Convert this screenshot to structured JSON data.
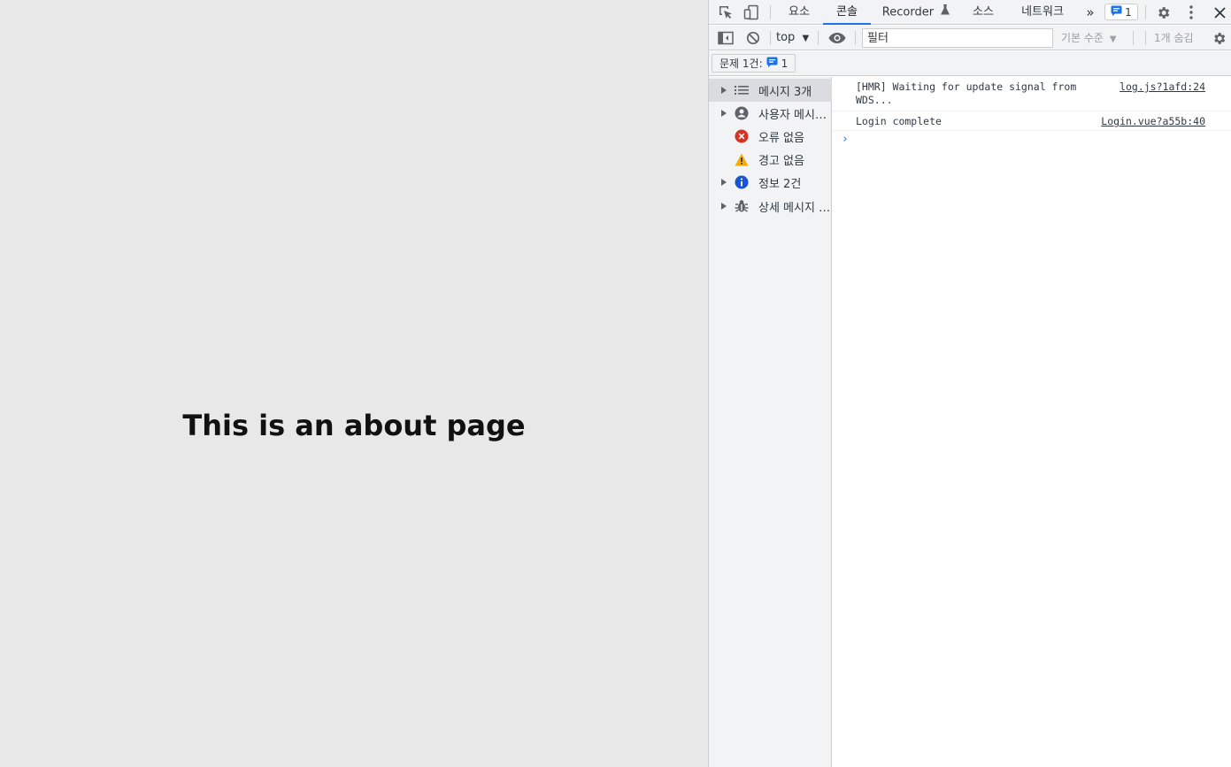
{
  "page": {
    "heading": "This is an about page"
  },
  "devtools": {
    "tabs": [
      {
        "label": "요소"
      },
      {
        "label": "콘솔"
      },
      {
        "label": "Recorder"
      },
      {
        "label": "소스"
      },
      {
        "label": "네트워크"
      }
    ],
    "active_tab": "콘솔",
    "more_tabs_label": "»",
    "issues_badge_count": "1",
    "toolbar": {
      "context": "top",
      "filter_placeholder": "필터",
      "levels": "기본 수준",
      "hidden_count": "1개 숨김"
    },
    "issues_row": {
      "label": "문제 1건:",
      "count": "1"
    },
    "sidebar": {
      "items": [
        {
          "label": "메시지 3개",
          "icon": "list-icon",
          "expandable": true
        },
        {
          "label": "사용자 메시지 없음",
          "icon": "user-icon",
          "expandable": true
        },
        {
          "label": "오류 없음",
          "icon": "error-icon",
          "expandable": false
        },
        {
          "label": "경고 없음",
          "icon": "warning-icon",
          "expandable": false
        },
        {
          "label": "정보 2건",
          "icon": "info-icon",
          "expandable": true
        },
        {
          "label": "상세 메시지 없음",
          "icon": "bug-icon",
          "expandable": true
        }
      ]
    },
    "messages": [
      {
        "text": "[HMR] Waiting for update signal from WDS...",
        "source": "log.js?1afd:24"
      },
      {
        "text": "Login complete",
        "source": "Login.vue?a55b:40"
      }
    ],
    "prompt": "›",
    "colors": {
      "accent": "#1a73e8",
      "error": "#d93025",
      "warning": "#f9ab00",
      "info": "#1a53d1"
    }
  }
}
